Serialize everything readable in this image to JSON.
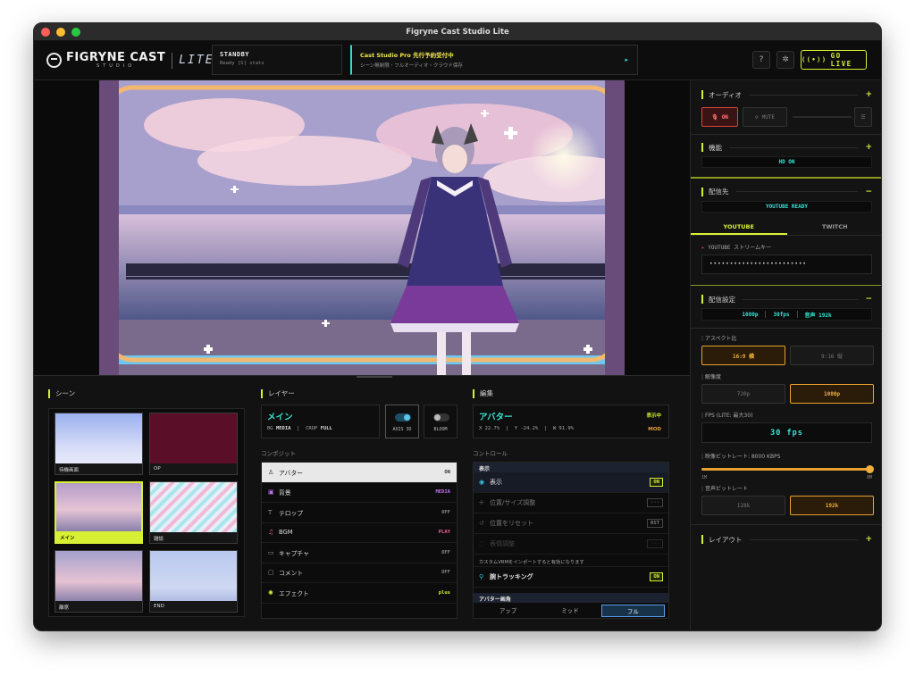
{
  "window": {
    "title": "Figryne Cast Studio Lite"
  },
  "header": {
    "logo_main": "FIGRYNE CAST",
    "logo_sub": "STUDIO",
    "logo_lite": "LITE",
    "status_title": "STANDBY",
    "status_sub": "Ready [S] stats",
    "promo_title": "Cast Studio Pro 先行予約受付中",
    "promo_sub": "シーン無制限・フルオーディオ・クラウド保存",
    "promo_arrow": "▸",
    "help_icon": "?",
    "settings_icon": "✲",
    "go_live_label": "GO LIVE"
  },
  "scenes": {
    "title": "シーン",
    "items": [
      {
        "label": "待機画面"
      },
      {
        "label": "OP"
      },
      {
        "label": "メイン"
      },
      {
        "label": "雑談"
      },
      {
        "label": "離席"
      },
      {
        "label": "END"
      }
    ]
  },
  "layers": {
    "title": "レイヤー",
    "card_title": "メイン",
    "card_meta_bg_key": "BG",
    "card_meta_bg_val": "MEDIA",
    "card_meta_crop_key": "CROP",
    "card_meta_crop_val": "FULL",
    "toggle_axis": "AXIS 3D",
    "toggle_bloom": "BLOOM",
    "composite_label": "コンポジット",
    "items": [
      {
        "icon": "♙",
        "label": "アバター",
        "value": "ON",
        "color": "#333333"
      },
      {
        "icon": "▣",
        "label": "背景",
        "value": "MEDIA",
        "color": "#c070f0"
      },
      {
        "icon": "T",
        "label": "テロップ",
        "value": "OFF",
        "color": "#888888"
      },
      {
        "icon": "♫",
        "label": "BGM",
        "value": "PLAY",
        "color": "#f060a0"
      },
      {
        "icon": "▭",
        "label": "キャプチャ",
        "value": "OFF",
        "color": "#888888"
      },
      {
        "icon": "▢",
        "label": "コメント",
        "value": "OFF",
        "color": "#888888"
      },
      {
        "icon": "✺",
        "label": "エフェクト",
        "value": "plus",
        "color": "#d8f034"
      }
    ]
  },
  "edit": {
    "title": "編集",
    "card_title": "アバター",
    "card_status": "表示中",
    "card_x": "X 22.7%",
    "card_y": "Y -24.2%",
    "card_w": "W 91.9%",
    "card_mod": "MOD",
    "control_label": "コントロール",
    "display_head": "表示",
    "rows": [
      {
        "icon": "◉",
        "label": "表示",
        "btn": "ON"
      },
      {
        "icon": "✛",
        "label": "位置/サイズ調整",
        "btn": "···"
      },
      {
        "icon": "↺",
        "label": "位置をリセット",
        "btn": "RST"
      },
      {
        "icon": "◌",
        "label": "表情調整",
        "btn": "···"
      }
    ],
    "note": "カスタムVRMをインポートすると有効になります",
    "tracking_label": "腕トラッキング",
    "tracking_btn": "ON",
    "tracking_icon": "⚲",
    "angle_head": "アバター画角",
    "angles": [
      "アップ",
      "ミッド",
      "フル"
    ]
  },
  "right": {
    "audio_title": "オーディオ",
    "audio_on": "ON",
    "audio_mute": "MUTE",
    "audio_plus": "+",
    "feature_title": "機能",
    "feature_plus": "+",
    "feature_value": "HD ON",
    "dest_title": "配信先",
    "dest_minus": "−",
    "dest_value": "YOUTUBE READY",
    "tab_youtube": "YOUTUBE",
    "tab_twitch": "TWITCH",
    "stream_key_label": "YOUTUBE ストリームキー",
    "stream_key_value": "••••••••••••••••••••••••",
    "settings_title": "配信設定",
    "settings_minus": "−",
    "pill_res": "1080p",
    "pill_fps": "30fps",
    "pill_audio": "音声 192k",
    "aspect_label": "アスペクト比",
    "aspect_a": "16:9 横",
    "aspect_b": "9:16 縦",
    "res_label": "解像度",
    "res_a": "720p",
    "res_b": "1080p",
    "fps_label": "FPS (LITE: 最大30)",
    "fps_value": "30 fps",
    "vbr_label": "映像ビットレート: 8000 KBPS",
    "vbr_fraction": 1.0,
    "vbr_min": "1M",
    "vbr_max": "8M",
    "abr_label": "音声ビットレート",
    "abr_a": "128k",
    "abr_b": "192k",
    "layout_title": "レイアウト",
    "layout_plus": "+"
  }
}
